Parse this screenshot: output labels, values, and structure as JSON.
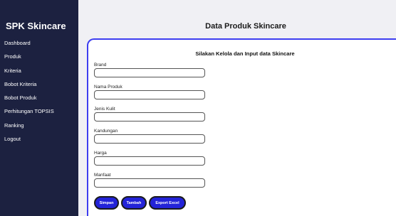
{
  "sidebar": {
    "brand": "SPK Skincare",
    "items": [
      {
        "label": "Dashboard"
      },
      {
        "label": "Produk"
      },
      {
        "label": "Kriteria"
      },
      {
        "label": "Bobot Kriteria"
      },
      {
        "label": "Bobot Produk"
      },
      {
        "label": "Perhitungan TOPSIS"
      },
      {
        "label": "Ranking"
      },
      {
        "label": "Logout"
      }
    ]
  },
  "main": {
    "title": "Data Produk Skincare",
    "form": {
      "title": "Silakan Kelola dan Input data Skincare",
      "fields": [
        {
          "label": "Brand",
          "value": ""
        },
        {
          "label": "Nama Produk",
          "value": ""
        },
        {
          "label": "Jenis Kulit",
          "value": ""
        },
        {
          "label": "Kandungan",
          "value": ""
        },
        {
          "label": "Harga",
          "value": ""
        },
        {
          "label": "Manfaat",
          "value": ""
        }
      ],
      "buttons": {
        "save": "Simpan",
        "add": "Tambah",
        "export": "Export Excel"
      }
    }
  },
  "colors": {
    "sidebar_bg": "#1c2140",
    "card_border": "#3d3df0",
    "button_bg": "#2323d8"
  }
}
